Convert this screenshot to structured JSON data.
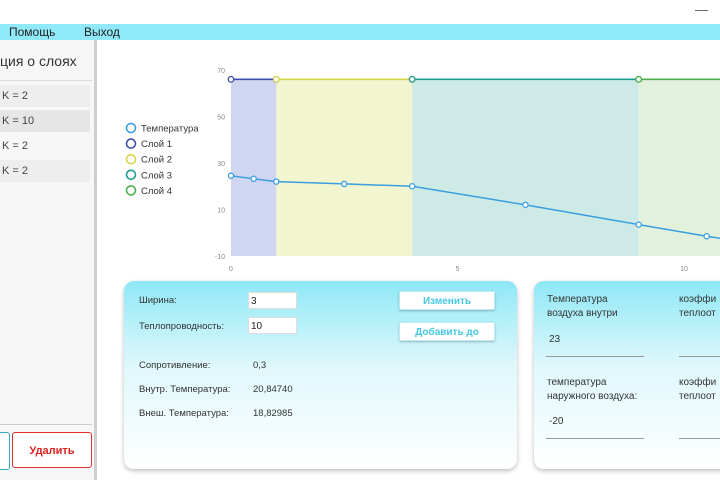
{
  "window": {
    "minimize_glyph": "—"
  },
  "menu": {
    "help": "Помощь",
    "exit": "Выход"
  },
  "sidebar": {
    "title": "ция о слоях",
    "layers": [
      {
        "label": "K = 2"
      },
      {
        "label": "K = 10"
      },
      {
        "label": "K = 2"
      },
      {
        "label": "K = 2"
      }
    ],
    "delete_label": "Удалить"
  },
  "chart_data": {
    "type": "line",
    "xlim": [
      0,
      11
    ],
    "ylim": [
      -10,
      70
    ],
    "xticks": [
      "0",
      "5",
      "10"
    ],
    "yticks": [
      "70",
      "50",
      "30",
      "10",
      "-10"
    ],
    "legend": [
      {
        "name": "Температура",
        "color": "#3a9ee0"
      },
      {
        "name": "Слой 1",
        "color": "#3f4fb0"
      },
      {
        "name": "Слой 2",
        "color": "#d6d64a"
      },
      {
        "name": "Слой 3",
        "color": "#1f9e92"
      },
      {
        "name": "Слой 4",
        "color": "#4cb04c"
      }
    ],
    "layers": [
      {
        "name": "Слой 1",
        "x": [
          0,
          1
        ],
        "top": 66,
        "color": "#3f4fb0",
        "fill": "#c8cfee"
      },
      {
        "name": "Слой 2",
        "x": [
          1,
          4
        ],
        "top": 66,
        "color": "#d6d64a",
        "fill": "#eff3c8"
      },
      {
        "name": "Слой 3",
        "x": [
          4,
          9
        ],
        "top": 66,
        "color": "#1f9e92",
        "fill": "#c6e6e3"
      },
      {
        "name": "Слой 4",
        "x": [
          9,
          11
        ],
        "top": 66,
        "color": "#4cb04c",
        "fill": "#ddefd6"
      }
    ],
    "temperature": {
      "x": [
        0,
        0.5,
        1,
        2.5,
        4,
        6.5,
        9,
        10.5,
        11
      ],
      "y": [
        24.5,
        23.2,
        22,
        21,
        20,
        12,
        3.5,
        -1.5,
        -3
      ]
    }
  },
  "layer_panel": {
    "width_label": "Ширина:",
    "width_value": "3",
    "conductivity_label": "Теплопроводность:",
    "conductivity_value": "10",
    "change_button": "Изменить",
    "add_before_button": "Добавить до",
    "resistance_label": "Сопротивление:",
    "resistance_value": "0,3",
    "inner_temp_label": "Внутр. Температура:",
    "inner_temp_value": "20,84740",
    "outer_temp_label": "Внеш. Температура:",
    "outer_temp_value": "18,82985"
  },
  "air_panel": {
    "inside_label_1": "Температура",
    "inside_label_2": "воздуха внутри",
    "inside_value": "23",
    "coef1_line1": "коэффи",
    "coef1_line2": "теплоот",
    "outside_label_1": "температура",
    "outside_label_2": "наружного воздуха:",
    "outside_value": "-20",
    "coef2_line1": "коэффи",
    "coef2_line2": "теплоот"
  }
}
